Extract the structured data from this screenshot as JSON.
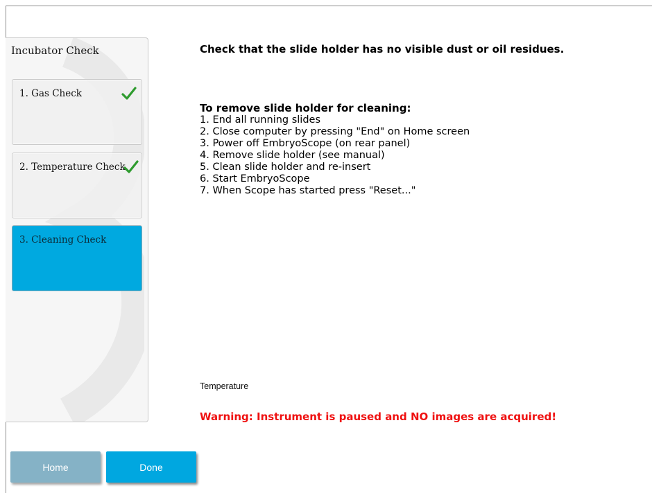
{
  "sidebar": {
    "title": "Incubator Check",
    "steps": [
      {
        "label": "1. Gas Check",
        "completed": true,
        "active": false
      },
      {
        "label": "2. Temperature Check",
        "completed": true,
        "active": false
      },
      {
        "label": "3. Cleaning Check",
        "completed": false,
        "active": true
      }
    ]
  },
  "main": {
    "heading": "Check that the slide holder has no visible dust or oil residues.",
    "instructions": {
      "title": "To remove slide holder for cleaning:",
      "steps": [
        "1. End all running slides",
        "2. Close computer by pressing \"End\" on Home screen",
        "3. Power off EmbryoScope (on rear panel)",
        "4. Remove slide holder (see manual)",
        "5. Clean slide holder and re-insert",
        "6. Start EmbryoScope",
        "7. When Scope has started press \"Reset...\""
      ]
    },
    "temperature_label": "Temperature",
    "warning": "Warning: Instrument is paused and NO images are acquired!"
  },
  "buttons": {
    "home_label": "Home",
    "done_label": "Done"
  },
  "icons": {
    "step_complete": "checkmark-icon"
  },
  "colors": {
    "accent": "#00a9e0",
    "home_button": "#85b2c6",
    "done_button": "#00a7e0",
    "warning": "#ef1010",
    "check_green": "#2e9b2e"
  }
}
